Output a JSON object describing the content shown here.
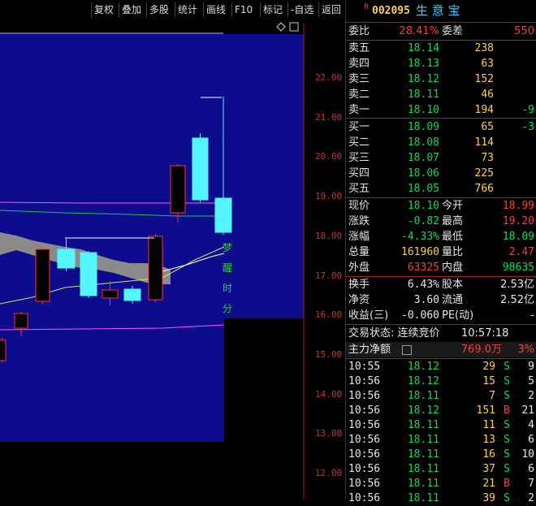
{
  "toolbar": {
    "buttons": [
      "复权",
      "叠加",
      "多股",
      "统计",
      "画线",
      "F10",
      "标记",
      "-自选",
      "返回"
    ]
  },
  "chart": {
    "y_ticks": [
      "22.00",
      "21.00",
      "20.00",
      "19.00",
      "18.00",
      "17.00",
      "16.00",
      "15.00",
      "14.00",
      "13.00",
      "12.00"
    ],
    "vertical_text": [
      "梦",
      "醒",
      "时",
      "分"
    ],
    "colors": {
      "up": "#ff3030",
      "down": "#54f5ff",
      "bg_panel": "#0c0c8c"
    }
  },
  "quote": {
    "r_mark": "R",
    "code": "002095",
    "name": "生 意 宝",
    "weibi_label": "委比",
    "weibi": "28.41%",
    "weicha_label": "委差",
    "weicha": "550",
    "asks": [
      {
        "label": "卖五",
        "price": "18.14",
        "vol": "238",
        "chg": ""
      },
      {
        "label": "卖四",
        "price": "18.13",
        "vol": "63",
        "chg": ""
      },
      {
        "label": "卖三",
        "price": "18.12",
        "vol": "152",
        "chg": ""
      },
      {
        "label": "卖二",
        "price": "18.11",
        "vol": "46",
        "chg": ""
      },
      {
        "label": "卖一",
        "price": "18.10",
        "vol": "194",
        "chg": "-9"
      }
    ],
    "bids": [
      {
        "label": "买一",
        "price": "18.09",
        "vol": "65",
        "chg": "-3"
      },
      {
        "label": "买二",
        "price": "18.08",
        "vol": "114",
        "chg": ""
      },
      {
        "label": "买三",
        "price": "18.07",
        "vol": "73",
        "chg": ""
      },
      {
        "label": "买四",
        "price": "18.06",
        "vol": "225",
        "chg": ""
      },
      {
        "label": "买五",
        "price": "18.05",
        "vol": "766",
        "chg": ""
      }
    ],
    "stats": [
      {
        "l1": "现价",
        "v1": "18.10",
        "c1": "green",
        "l2": "今开",
        "v2": "18.99",
        "c2": "red"
      },
      {
        "l1": "涨跌",
        "v1": "-0.82",
        "c1": "green",
        "l2": "最高",
        "v2": "19.20",
        "c2": "red"
      },
      {
        "l1": "涨幅",
        "v1": "-4.33%",
        "c1": "green",
        "l2": "最低",
        "v2": "18.09",
        "c2": "green"
      },
      {
        "l1": "总量",
        "v1": "161960",
        "c1": "yellow",
        "l2": "量比",
        "v2": "2.47",
        "c2": "red"
      },
      {
        "l1": "外盘",
        "v1": "63325",
        "c1": "red",
        "l2": "内盘",
        "v2": "98635",
        "c2": "green"
      }
    ],
    "fin": [
      {
        "l1": "换手",
        "v1": "6.43%",
        "l2": "股本",
        "v2": "2.53亿"
      },
      {
        "l1": "净资",
        "v1": "3.60",
        "l2": "流通",
        "v2": "2.52亿"
      },
      {
        "l1": "收益(三)",
        "v1": "-0.060",
        "l2": "PE(动)",
        "v2": "-"
      }
    ],
    "trade_status": "交易状态: 连续竞价",
    "trade_time": "10:57:18",
    "main_flow_label": "主力净额",
    "main_flow_value": "769.0万",
    "main_flow_pct": "3%"
  },
  "ticks": [
    {
      "time": "10:55",
      "price": "18.12",
      "vol": "29",
      "side": "S",
      "n": "9"
    },
    {
      "time": "10:56",
      "price": "18.12",
      "vol": "15",
      "side": "S",
      "n": "5"
    },
    {
      "time": "10:56",
      "price": "18.11",
      "vol": "7",
      "side": "S",
      "n": "2"
    },
    {
      "time": "10:56",
      "price": "18.12",
      "vol": "151",
      "side": "B",
      "n": "21"
    },
    {
      "time": "10:56",
      "price": "18.11",
      "vol": "11",
      "side": "S",
      "n": "4"
    },
    {
      "time": "10:56",
      "price": "18.11",
      "vol": "13",
      "side": "S",
      "n": "6"
    },
    {
      "time": "10:56",
      "price": "18.11",
      "vol": "16",
      "side": "S",
      "n": "10"
    },
    {
      "time": "10:56",
      "price": "18.11",
      "vol": "37",
      "side": "S",
      "n": "6"
    },
    {
      "time": "10:56",
      "price": "18.11",
      "vol": "21",
      "side": "B",
      "n": "7"
    },
    {
      "time": "10:56",
      "price": "18.11",
      "vol": "39",
      "side": "S",
      "n": "2"
    }
  ]
}
